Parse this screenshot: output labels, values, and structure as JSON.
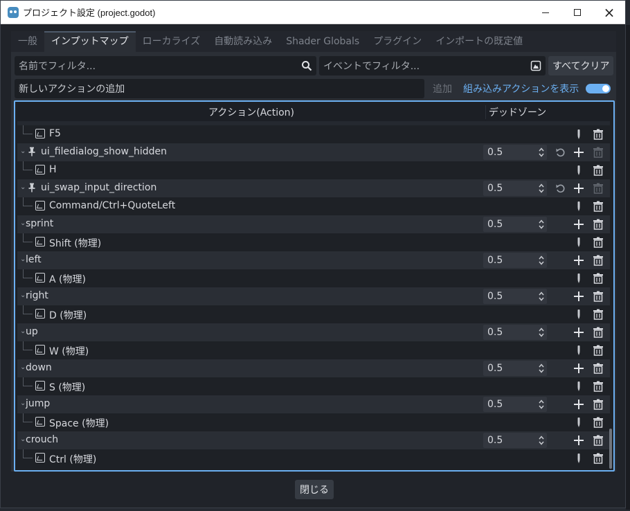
{
  "window": {
    "title": "プロジェクト設定 (project.godot)",
    "minimize": "minimize-icon",
    "maximize": "maximize-icon",
    "close": "×"
  },
  "tabs": [
    {
      "label": "一般",
      "active": false
    },
    {
      "label": "インプットマップ",
      "active": true
    },
    {
      "label": "ローカライズ",
      "active": false
    },
    {
      "label": "自動読み込み",
      "active": false
    },
    {
      "label": "Shader Globals",
      "active": false
    },
    {
      "label": "プラグイン",
      "active": false
    },
    {
      "label": "インポートの既定値",
      "active": false
    }
  ],
  "filters": {
    "name_placeholder": "名前でフィルタ...",
    "event_placeholder": "イベントでフィルタ...",
    "clear_all": "すべてクリア"
  },
  "add_action": {
    "placeholder": "新しいアクションの追加",
    "add_button": "追加",
    "builtin_label": "組み込みアクションを表示",
    "builtin_on": true
  },
  "tree": {
    "col_action": "アクション(Action)",
    "col_deadzone": "デッドゾーン",
    "rows": [
      {
        "kind": "event",
        "label": "F5"
      },
      {
        "kind": "action",
        "label": "ui_filedialog_show_hidden",
        "builtin": true,
        "deadzone": "0.5"
      },
      {
        "kind": "event",
        "label": "H"
      },
      {
        "kind": "action",
        "label": "ui_swap_input_direction",
        "builtin": true,
        "deadzone": "0.5"
      },
      {
        "kind": "event",
        "label": "Command/Ctrl+QuoteLeft"
      },
      {
        "kind": "action",
        "label": "sprint",
        "builtin": false,
        "deadzone": "0.5"
      },
      {
        "kind": "event",
        "label": "Shift (物理)"
      },
      {
        "kind": "action",
        "label": "left",
        "builtin": false,
        "deadzone": "0.5"
      },
      {
        "kind": "event",
        "label": "A (物理)"
      },
      {
        "kind": "action",
        "label": "right",
        "builtin": false,
        "deadzone": "0.5"
      },
      {
        "kind": "event",
        "label": "D (物理)"
      },
      {
        "kind": "action",
        "label": "up",
        "builtin": false,
        "deadzone": "0.5"
      },
      {
        "kind": "event",
        "label": "W (物理)"
      },
      {
        "kind": "action",
        "label": "down",
        "builtin": false,
        "deadzone": "0.5"
      },
      {
        "kind": "event",
        "label": "S (物理)"
      },
      {
        "kind": "action",
        "label": "jump",
        "builtin": false,
        "deadzone": "0.5"
      },
      {
        "kind": "event",
        "label": "Space (物理)"
      },
      {
        "kind": "action",
        "label": "crouch",
        "builtin": false,
        "deadzone": "0.5"
      },
      {
        "kind": "event",
        "label": "Ctrl (物理)"
      }
    ]
  },
  "footer": {
    "close_label": "閉じる"
  },
  "colors": {
    "accent": "#6cb0f2",
    "panel": "#2b2f36",
    "dark": "#1e2126"
  }
}
